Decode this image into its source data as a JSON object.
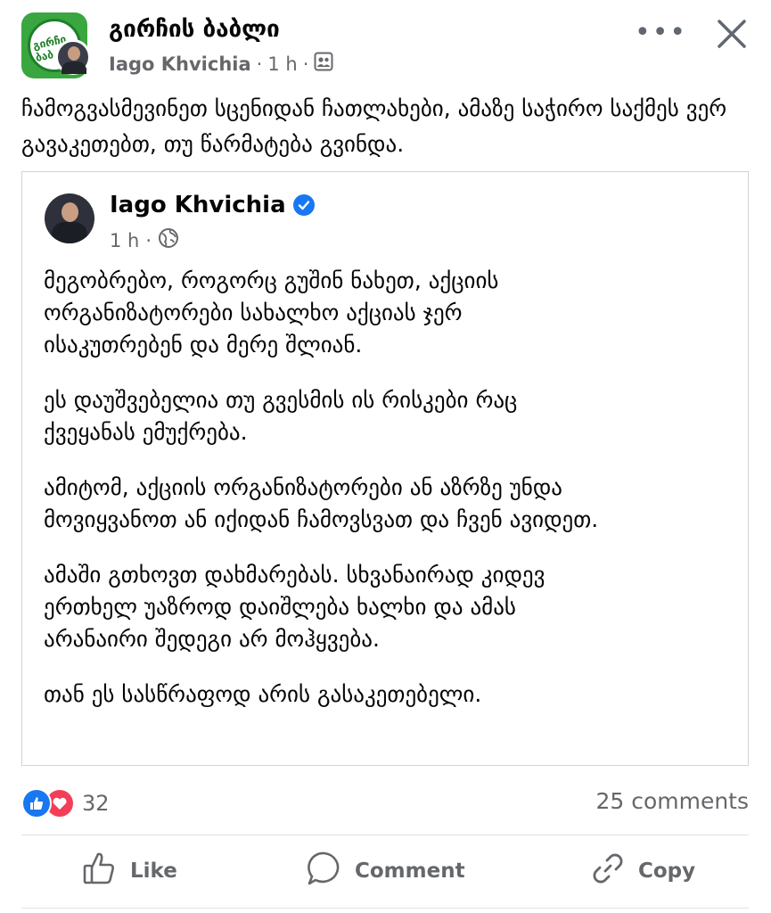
{
  "header": {
    "group_name": "გირჩის ბაბლი",
    "author": "Iago Khvichia",
    "separator": "·",
    "time": "1 h",
    "group_avatar_text": "გირჩი ბაბ",
    "audience_icon": "group-members-icon",
    "more_icon": "more-options-icon",
    "close_icon": "close-icon"
  },
  "post": {
    "text": "ჩამოგვასმევინეთ სცენიდან ჩათლახები, ამაზე საჭირო საქმეს ვერ გავაკეთებთ, თუ წარმატება გვინდა."
  },
  "shared_post": {
    "author": "Iago Khvichia",
    "verified_icon": "verified-badge-icon",
    "time": "1 h",
    "separator": "·",
    "audience_icon": "globe-icon",
    "paragraphs": [
      "მეგობრებო, როგორც გუშინ ნახეთ, აქციის\nორგანიზატორები სახალხო აქციას ჯერ\nისაკუთრებენ და მერე შლიან.",
      "ეს დაუშვებელია თუ გვესმის ის რისკები რაც\nქვეყანას ემუქრება.",
      "ამიტომ, აქციის ორგანიზატორები ან აზრზე უნდა\nმოვიყვანოთ ან იქიდან ჩამოვსვათ და ჩვენ ავიდეთ.",
      "ამაში გთხოვთ დახმარებას. სხვანაირად კიდევ\nერთხელ უაზროდ დაიშლება ხალხი და ამას\nარანაირი შედეგი არ მოჰყვება.",
      "თან ეს სასწრაფოდ არის გასაკეთებელი."
    ]
  },
  "stats": {
    "reaction_count": "32",
    "comments": "25 comments",
    "reaction_icons": [
      "like-reaction-icon",
      "love-reaction-icon"
    ],
    "colors": {
      "like": "#1877f2",
      "love": "#f33e58"
    }
  },
  "actions": {
    "like": "Like",
    "comment": "Comment",
    "copy": "Copy"
  }
}
